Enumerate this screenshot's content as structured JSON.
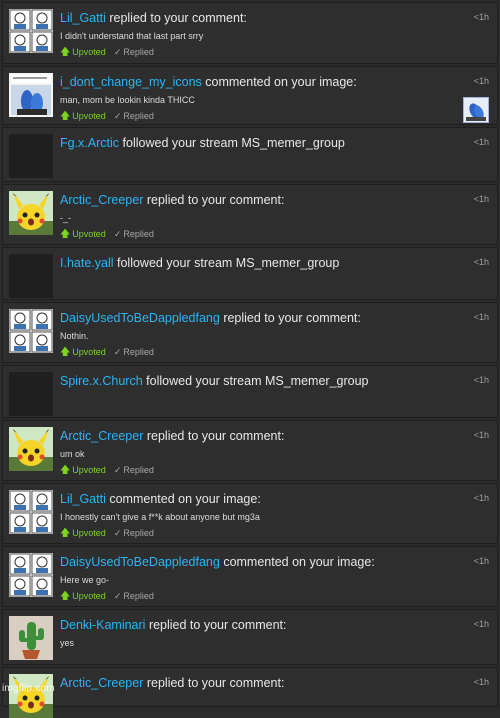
{
  "notifications": [
    {
      "username": "Lil_Gatti",
      "action": "replied to your comment:",
      "message": "I didn't understand that last part srry",
      "time": "<1h",
      "status": {
        "upvoted": "Upvoted",
        "replied": "Replied"
      },
      "avatar_icon": "meme-face-avatar-icon"
    },
    {
      "username": "i_dont_change_my_icons",
      "action": "commented on your image:",
      "message": "man, mom be lookin kinda THICC",
      "time": "<1h",
      "status": {
        "upvoted": "Upvoted",
        "replied": "Replied"
      },
      "avatar_icon": "feet-image-avatar-icon",
      "thumbnail_icon": "image-thumbnail-icon"
    },
    {
      "username": "Fg.x.Arctic",
      "action": "followed your stream MS_memer_group",
      "message": "",
      "time": "<1h",
      "avatar_icon": "blank-avatar-icon"
    },
    {
      "username": "Arctic_Creeper",
      "action": "replied to your comment:",
      "message": "-_-",
      "time": "<1h",
      "status": {
        "upvoted": "Upvoted",
        "replied": "Replied"
      },
      "avatar_icon": "pikachu-avatar-icon"
    },
    {
      "username": "I.hate.yall",
      "action": "followed your stream MS_memer_group",
      "message": "",
      "time": "<1h",
      "avatar_icon": "blank-avatar-icon"
    },
    {
      "username": "DaisyUsedToBeDappledfang",
      "action": "replied to your comment:",
      "message": "Nothin.",
      "time": "<1h",
      "status": {
        "upvoted": "Upvoted",
        "replied": "Replied"
      },
      "avatar_icon": "meme-face-avatar-icon"
    },
    {
      "username": "Spire.x.Church",
      "action": "followed your stream MS_memer_group",
      "message": "",
      "time": "<1h",
      "avatar_icon": "blank-avatar-icon"
    },
    {
      "username": "Arctic_Creeper",
      "action": "replied to your comment:",
      "message": "um ok",
      "time": "<1h",
      "status": {
        "upvoted": "Upvoted",
        "replied": "Replied"
      },
      "avatar_icon": "pikachu-avatar-icon"
    },
    {
      "username": "Lil_Gatti",
      "action": "commented on your image:",
      "message": "I honestly can't give a f**k about anyone but mg3a",
      "time": "<1h",
      "status": {
        "upvoted": "Upvoted",
        "replied": "Replied"
      },
      "avatar_icon": "meme-face-avatar-icon"
    },
    {
      "username": "DaisyUsedToBeDappledfang",
      "action": "commented on your image:",
      "message": "Here we go-",
      "time": "<1h",
      "status": {
        "upvoted": "Upvoted",
        "replied": "Replied"
      },
      "avatar_icon": "meme-face-avatar-icon"
    },
    {
      "username": "Denki-Kaminari",
      "action": "replied to your comment:",
      "message": "yes",
      "time": "<1h",
      "avatar_icon": "cactus-avatar-icon"
    },
    {
      "username": "Arctic_Creeper",
      "action": "replied to your comment:",
      "message": "",
      "time": "<1h",
      "avatar_icon": "pikachu-avatar-icon"
    }
  ],
  "watermark": "imgflip.com",
  "colors": {
    "background": "#2b2b2b",
    "username": "#29b6f6",
    "upvoted": "#7ed321",
    "muted": "#a8a8a8"
  }
}
